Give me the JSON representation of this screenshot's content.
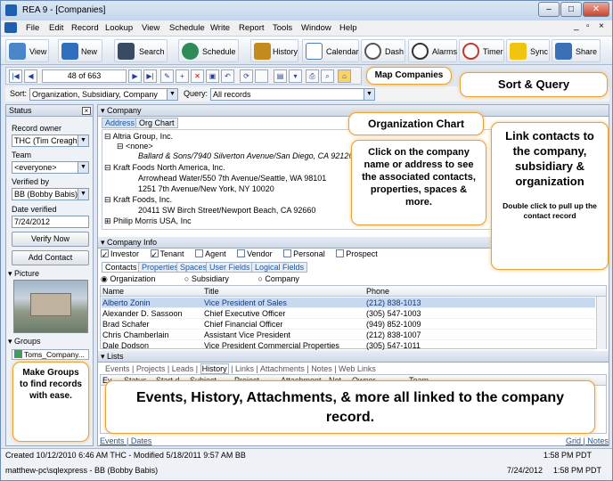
{
  "window": {
    "title": "REA 9 - [Companies]",
    "controls": [
      "–",
      "□",
      "✕"
    ]
  },
  "menu": [
    "File",
    "Edit",
    "Record",
    "Lookup",
    "View",
    "Schedule",
    "Write",
    "Report",
    "Tools",
    "Window",
    "Help"
  ],
  "toolbar": [
    {
      "label": "View",
      "icon": "view-icon",
      "color": "#4a86c8"
    },
    {
      "label": "New",
      "icon": "new-record-icon",
      "color": "#2f6fbd"
    },
    {
      "label": "Search",
      "icon": "binoculars-icon",
      "color": "#3b4a63"
    },
    {
      "label": "Schedule",
      "icon": "schedule-icon",
      "color": "#2e8b57"
    },
    {
      "label": "History",
      "icon": "history-icon",
      "color": "#c58a1e"
    },
    {
      "label": "Calendar",
      "icon": "calendar-icon",
      "color": "#4f79b5"
    },
    {
      "label": "Dash",
      "icon": "dashboard-icon",
      "color": "#555555"
    },
    {
      "label": "Alarms",
      "icon": "alarm-clock-icon",
      "color": "#333333"
    },
    {
      "label": "Timer",
      "icon": "timer-icon",
      "color": "#c0392b"
    },
    {
      "label": "Sync",
      "icon": "sync-icon",
      "color": "#f1c40f"
    },
    {
      "label": "Share",
      "icon": "share-icon",
      "color": "#3b6fb6"
    }
  ],
  "nav": {
    "record_pos": "48 of 663"
  },
  "sort": {
    "label": "Sort:",
    "value": "Organization, Subsidiary, Company",
    "query_label": "Query:",
    "query_value": "All records"
  },
  "status_panel": {
    "title": "Status",
    "record_owner_label": "Record owner",
    "record_owner": "THC (Tim Creagh)",
    "team_label": "Team",
    "team": "<everyone>",
    "verified_by_label": "Verified by",
    "verified_by": "BB (Bobby Babis)",
    "date_verified_label": "Date verified",
    "date_verified": "7/24/2012",
    "verify_btn": "Verify Now",
    "add_contact_btn": "Add Contact",
    "picture_label": "Picture",
    "groups_label": "Groups",
    "group_item": "Toms_Company..."
  },
  "company": {
    "section_label": "Company",
    "tabs": [
      "Address",
      "Org Chart"
    ],
    "tree": [
      {
        "indent": 0,
        "text": "Altria Group, Inc."
      },
      {
        "indent": 1,
        "text": "<none>"
      },
      {
        "indent": 2,
        "text": "Ballard & Sons/7940 Silverton Avenue/San Diego, CA 92126",
        "italic": true
      },
      {
        "indent": 0,
        "text": "Kraft Foods North America, Inc."
      },
      {
        "indent": 2,
        "text": "Arrowhead Water/550 7th Avenue/Seattle, WA 98101"
      },
      {
        "indent": 2,
        "text": "1251 7th Avenue/New York, NY 10020"
      },
      {
        "indent": 0,
        "text": "Kraft Foods, Inc."
      },
      {
        "indent": 2,
        "text": "20411 SW Birch Street/Newport Beach, CA 92660"
      },
      {
        "indent": 0,
        "text": "Philip Morris USA, Inc"
      }
    ]
  },
  "company_info": {
    "section_label": "Company Info",
    "checkboxes": [
      {
        "label": "Investor",
        "checked": true
      },
      {
        "label": "Tenant",
        "checked": true
      },
      {
        "label": "Agent",
        "checked": false
      },
      {
        "label": "Vendor",
        "checked": false
      },
      {
        "label": "Personal",
        "checked": false
      },
      {
        "label": "Prospect",
        "checked": false
      }
    ],
    "tabs": [
      "Contacts",
      "Properties",
      "Spaces",
      "User Fields",
      "Logical Fields"
    ],
    "radios": [
      "Organization",
      "Subsidiary",
      "Company"
    ],
    "columns": [
      "Name",
      "Title",
      "Phone"
    ],
    "rows": [
      {
        "name": "Alberto Zonin",
        "title": "Vice President of Sales",
        "phone": "(212) 838-1013",
        "selected": true
      },
      {
        "name": "Alexander D. Sassoon",
        "title": "Chief Executive Officer",
        "phone": "(305) 547-1003"
      },
      {
        "name": "Brad Schafer",
        "title": "Chief Financial Officer",
        "phone": "(949) 852-1009"
      },
      {
        "name": "Chris Chamberlain",
        "title": "Assistant Vice President",
        "phone": "(212) 838-1007"
      },
      {
        "name": "Dale Dodson",
        "title": "Vice President Commercial Properties",
        "phone": "(305) 547-1011"
      }
    ]
  },
  "lists": {
    "section_label": "Lists",
    "tabs": [
      "Events",
      "Projects",
      "Leads",
      "History",
      "Links",
      "Attachments",
      "Notes",
      "Web Links"
    ],
    "columns": [
      "Ev...",
      "Status",
      "Start d...",
      "Subject",
      "Project",
      "Attachment",
      "Not...",
      "Owner",
      "Team"
    ],
    "footer_left": [
      "Events",
      "Dates"
    ],
    "footer_right": [
      "Grid",
      "Notes"
    ]
  },
  "callouts": {
    "map": "Map Companies",
    "sort_query": "Sort & Query",
    "org_chart_title": "Organization Chart",
    "org_chart_body": "Click on the company name or address to see the associated contacts, properties, spaces & more.",
    "link_title": "Link contacts to the company, subsidiary & organization",
    "link_small": "Double click to pull up the contact record",
    "groups": "Make Groups to find records with ease.",
    "events": "Events, History, Attachments, & more all linked to the company record."
  },
  "status_bar": {
    "created": "Created 10/12/2010 6:46 AM THC - Modified 5/18/2011 9:57 AM BB",
    "server": "matthew-pc\\sqlexpress - BB (Bobby Babis)",
    "time1": "1:58 PM PDT",
    "date_time": "7/24/2012",
    "time2": "1:58 PM PDT"
  }
}
